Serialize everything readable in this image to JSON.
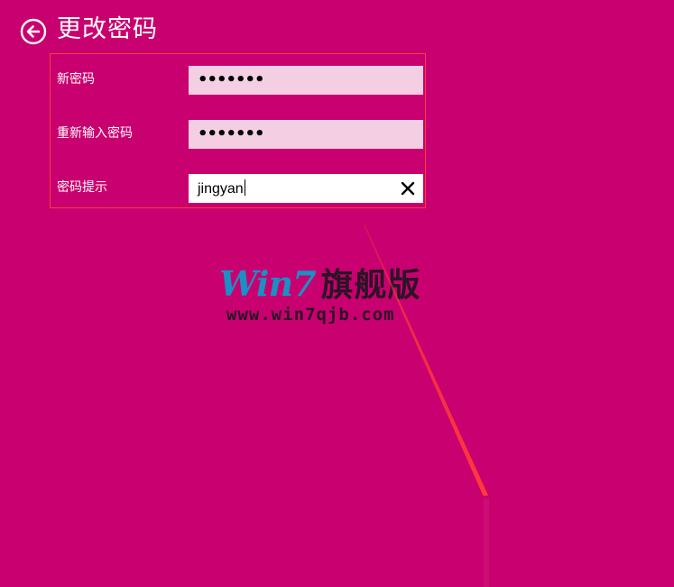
{
  "header": {
    "back_icon": "back-arrow-circle-icon",
    "title": "更改密码"
  },
  "form": {
    "new_password": {
      "label": "新密码",
      "masked_value": "•••••••"
    },
    "confirm_password": {
      "label": "重新输入密码",
      "masked_value": "•••••••"
    },
    "password_hint": {
      "label": "密码提示",
      "value": "jingyan",
      "clear_icon": "close-icon"
    }
  },
  "watermark": {
    "brand_latin": "Win7",
    "brand_cjk": "旗舰版",
    "url": "www.win7qjb.com"
  },
  "colors": {
    "background": "#c9006f",
    "field_fill": "#f4cfe4",
    "highlight_border": "#ff3b3b",
    "annotation_arrow": "#ff3b3b"
  }
}
